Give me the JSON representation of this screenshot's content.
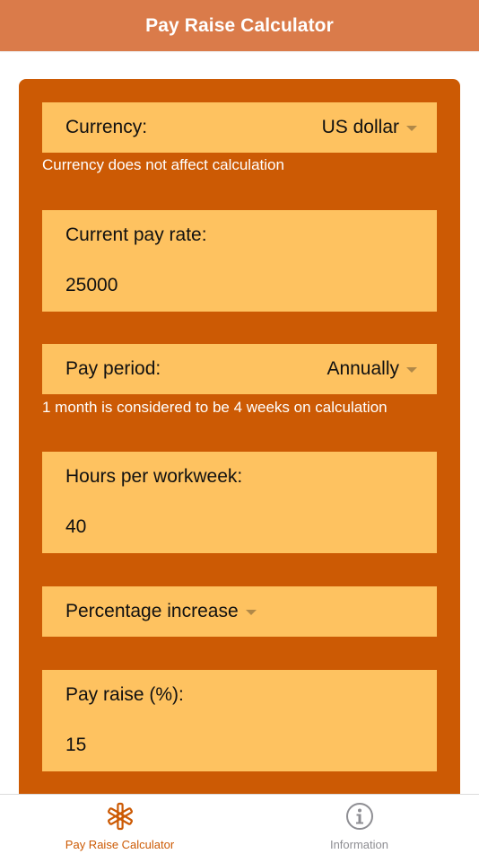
{
  "header": {
    "title": "Pay Raise Calculator"
  },
  "form": {
    "currency": {
      "label": "Currency:",
      "value": "US dollar",
      "note": "Currency does not affect calculation"
    },
    "current_pay_rate": {
      "label": "Current pay rate:",
      "value": "25000"
    },
    "pay_period": {
      "label": "Pay period:",
      "value": "Annually",
      "note": "1 month is considered to be 4 weeks on calculation"
    },
    "hours_per_workweek": {
      "label": "Hours per workweek:",
      "value": "40"
    },
    "raise_type": {
      "value": "Percentage increase"
    },
    "pay_raise": {
      "label": "Pay raise (%):",
      "value": "15"
    }
  },
  "tabs": [
    {
      "label": "Pay Raise Calculator",
      "icon": "asterisk-icon",
      "active": true
    },
    {
      "label": "Information",
      "icon": "info-icon",
      "active": false
    }
  ],
  "colors": {
    "header": "#DA7B4A",
    "panel": "#CC5A04",
    "card": "#FEC260",
    "active_tab": "#CC5A04",
    "inactive_tab": "#8e8e93"
  }
}
